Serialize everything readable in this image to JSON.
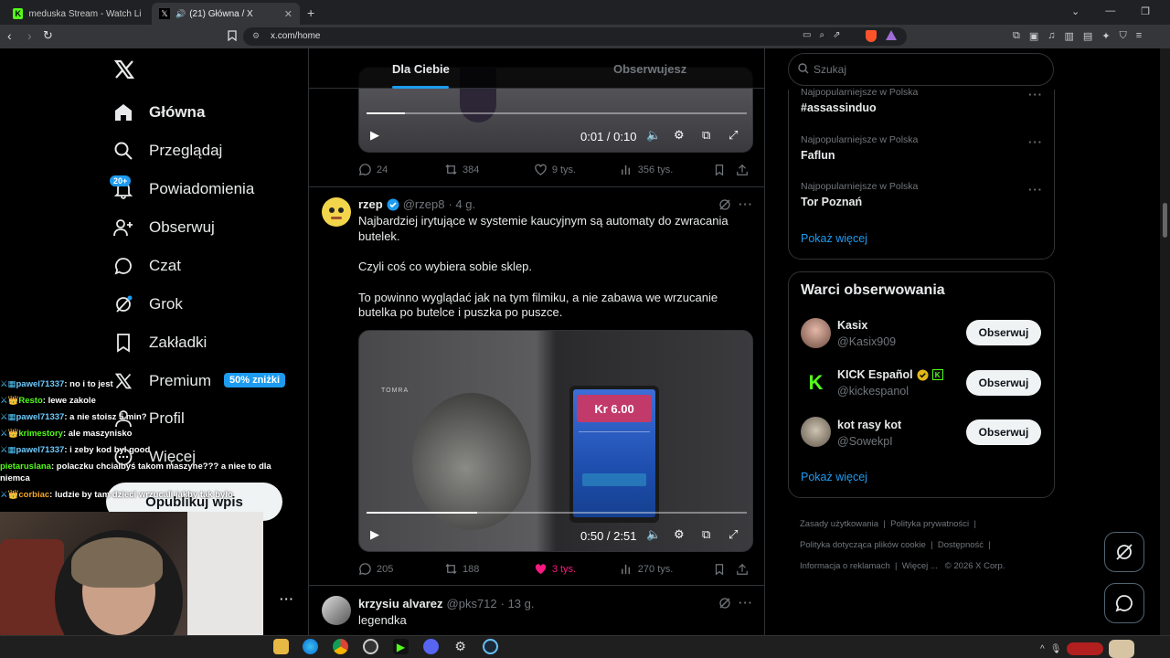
{
  "browser": {
    "tabs": [
      {
        "title": "meduska Stream - Watch Live on Kic"
      },
      {
        "title": "(21) Główna / X"
      }
    ],
    "url": "x.com/home"
  },
  "nav": {
    "items": [
      {
        "label": "Główna",
        "icon": "home-icon"
      },
      {
        "label": "Przeglądaj",
        "icon": "search-icon"
      },
      {
        "label": "Powiadomienia",
        "icon": "bell-icon"
      },
      {
        "label": "Obserwuj",
        "icon": "follow-icon"
      },
      {
        "label": "Czat",
        "icon": "chat-icon"
      },
      {
        "label": "Grok",
        "icon": "grok-icon"
      },
      {
        "label": "Zakładki",
        "icon": "bookmark-icon"
      },
      {
        "label": "Premium",
        "icon": "x-logo-icon"
      },
      {
        "label": "Profil",
        "icon": "profile-icon"
      },
      {
        "label": "Więcej",
        "icon": "more-icon"
      }
    ],
    "notif_badge": "20+",
    "premium_badge": "50% zniżki",
    "post_button": "Opublikuj wpis"
  },
  "chat": [
    {
      "user": "pawel71337",
      "text": "no i to jest"
    },
    {
      "user": "Resto",
      "text": "lewe zakole"
    },
    {
      "user": "pawel71337",
      "text": "a nie stoisz 5 min?"
    },
    {
      "user": "krimestory",
      "text": "ale maszynisko"
    },
    {
      "user": "pawel71337",
      "text": "i zeby kod byl good"
    },
    {
      "user": "pietaruslana",
      "text": "polaczku chcialbyś takom maszyne??? a niee to dla niemca"
    },
    {
      "user": "corbiac",
      "text": "ludzie by tam dzieci wrzucali jakby tak było"
    }
  ],
  "timeline": {
    "tabs": [
      "Dla Ciebie",
      "Obserwujesz"
    ],
    "tweet1": {
      "video_time": "0:01 / 0:10",
      "progress": 0.1,
      "replies": "24",
      "reposts": "384",
      "likes": "9 tys.",
      "views": "356 tys."
    },
    "tweet2": {
      "name": "rzep",
      "handle": "@rzep8",
      "time": "· 4 g.",
      "text1": "Najbardziej irytujące w systemie kaucyjnym są automaty do zwracania butelek.",
      "text2": "Czyli coś co wybiera sobie sklep.",
      "text3": "To powinno wyglądać jak na tym filmiku, a nie zabawa we wrzucanie butelka po butelce i puszka po puszce.",
      "machine_brand": "TOMRA",
      "screen_value": "Kr 6.00",
      "video_time": "0:50 / 2:51",
      "progress": 0.29,
      "replies": "205",
      "reposts": "188",
      "likes": "3 tys.",
      "views": "270 tys.",
      "liked": true
    },
    "tweet3": {
      "name": "krzysiu alvarez",
      "handle": "@pks712",
      "time": "· 13 g.",
      "text": "legendka"
    }
  },
  "right": {
    "search_placeholder": "Szukaj",
    "trends": [
      {
        "meta": "Najpopularniejsze w Polska",
        "name": "#assassinduo"
      },
      {
        "meta": "Najpopularniejsze w Polska",
        "name": "Faflun"
      },
      {
        "meta": "Najpopularniejsze w Polska",
        "name": "Tor Poznań"
      }
    ],
    "show_more": "Pokaż więcej",
    "who_title": "Warci obserwowania",
    "who": [
      {
        "name": "Kasix",
        "handle": "@Kasix909",
        "button": "Obserwuj"
      },
      {
        "name": "KICK Español",
        "handle": "@kickespanol",
        "button": "Obserwuj"
      },
      {
        "name": "kot rasy kot",
        "handle": "@SowekpI",
        "button": "Obserwuj"
      }
    ],
    "footer": {
      "terms": "Zasady użytkowania",
      "privacy": "Polityka prywatności",
      "cookies": "Polityka dotycząca plików cookie",
      "access": "Dostępność",
      "ads": "Informacja o reklamach",
      "more": "Więcej ...",
      "copy": "© 2026 X Corp."
    }
  },
  "colors": {
    "accent": "#1d9bf0",
    "like": "#f91880",
    "kick": "#53fc18"
  }
}
